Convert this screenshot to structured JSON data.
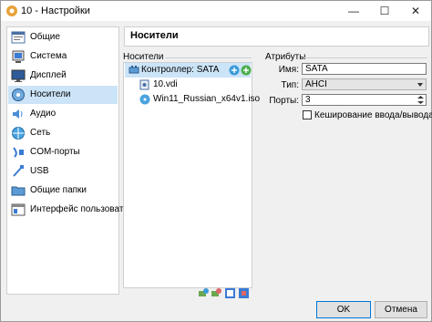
{
  "window": {
    "title": "10 - Настройки",
    "minimize": "—",
    "maximize": "☐",
    "close": "✕"
  },
  "sidebar": {
    "items": [
      {
        "label": "Общие",
        "icon": "general-icon"
      },
      {
        "label": "Система",
        "icon": "system-icon"
      },
      {
        "label": "Дисплей",
        "icon": "display-icon"
      },
      {
        "label": "Носители",
        "icon": "storage-icon",
        "selected": true
      },
      {
        "label": "Аудио",
        "icon": "audio-icon"
      },
      {
        "label": "Сеть",
        "icon": "network-icon"
      },
      {
        "label": "COM-порты",
        "icon": "serial-ports-icon"
      },
      {
        "label": "USB",
        "icon": "usb-icon"
      },
      {
        "label": "Общие папки",
        "icon": "shared-folders-icon"
      },
      {
        "label": "Интерфейс пользователя",
        "icon": "user-interface-icon"
      }
    ]
  },
  "page": {
    "title": "Носители"
  },
  "storage": {
    "label": "Носители",
    "controller": "Контроллер: SATA",
    "devices": [
      {
        "name": "10.vdi",
        "icon": "hard-disk-icon"
      },
      {
        "name": "Win11_Russian_x64v1.iso",
        "icon": "optical-disc-icon"
      }
    ]
  },
  "attributes": {
    "label": "Атрибуты",
    "name_label": "Имя:",
    "name_value": "SATA",
    "type_label": "Тип:",
    "type_value": "AHCI",
    "ports_label": "Порты:",
    "ports_value": "3",
    "cache_label": "Кеширование ввода/вывода",
    "cache_checked": false
  },
  "buttons": {
    "ok": "OK",
    "cancel": "Отмена"
  },
  "colors": {
    "selection": "#cce4f7",
    "accent": "#0078d7"
  }
}
